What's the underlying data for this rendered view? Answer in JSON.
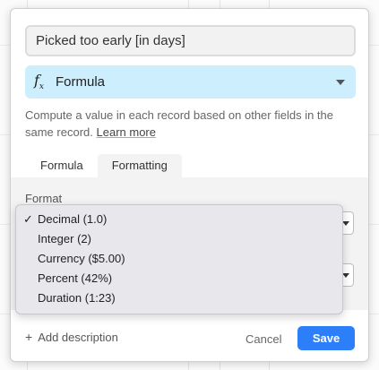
{
  "field": {
    "name_value": "Picked too early [in days]",
    "type_label": "Formula",
    "type_icon": "formula-fx-icon"
  },
  "help": {
    "text": "Compute a value in each record based on other fields in the same record.",
    "link": "Learn more"
  },
  "tabs": [
    {
      "label": "Formula",
      "active": false
    },
    {
      "label": "Formatting",
      "active": true
    }
  ],
  "formatting": {
    "format_label": "Format",
    "options": [
      {
        "label": "Decimal (1.0)",
        "selected": true
      },
      {
        "label": "Integer (2)",
        "selected": false
      },
      {
        "label": "Currency ($5.00)",
        "selected": false
      },
      {
        "label": "Percent (42%)",
        "selected": false
      },
      {
        "label": "Duration (1:23)",
        "selected": false
      }
    ],
    "check_glyph": "✓"
  },
  "footer": {
    "add_description": "Add description",
    "plus_glyph": "+",
    "cancel": "Cancel",
    "save": "Save"
  },
  "colors": {
    "accent": "#2d7ff9",
    "type_bg": "#cdeefc"
  }
}
